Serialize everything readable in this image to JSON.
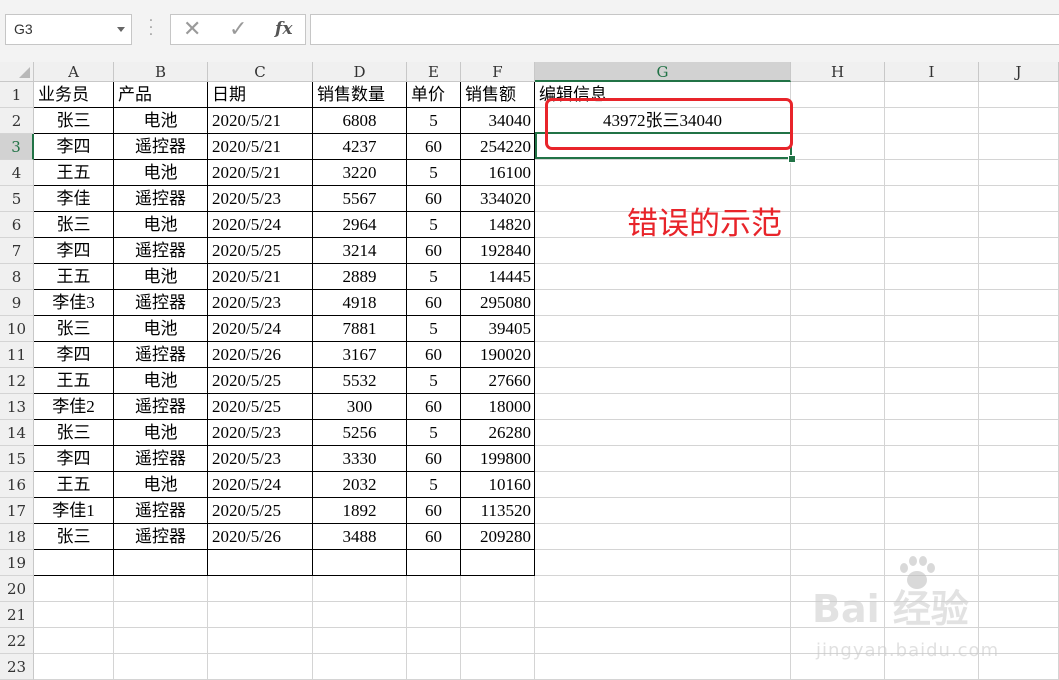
{
  "name_box": {
    "value": "G3"
  },
  "formula_bar": {
    "cancel_icon": "✕",
    "enter_icon": "✓",
    "fx_label": "fx",
    "formula": ""
  },
  "columns": [
    "A",
    "B",
    "C",
    "D",
    "E",
    "F",
    "G",
    "H",
    "I",
    "J"
  ],
  "selected_column": "G",
  "selected_row": 3,
  "row_numbers": [
    "1",
    "2",
    "3",
    "4",
    "5",
    "6",
    "7",
    "8",
    "9",
    "10",
    "11",
    "12",
    "13",
    "14",
    "15",
    "16",
    "17",
    "18",
    "19",
    "20",
    "21",
    "22",
    "23"
  ],
  "headers": [
    "业务员",
    "产品",
    "日期",
    "销售数量",
    "单价",
    "销售额",
    "编辑信息"
  ],
  "rows": [
    [
      "张三",
      "电池",
      "2020/5/21",
      "6808",
      "5",
      "34040"
    ],
    [
      "李四",
      "遥控器",
      "2020/5/21",
      "4237",
      "60",
      "254220"
    ],
    [
      "王五",
      "电池",
      "2020/5/21",
      "3220",
      "5",
      "16100"
    ],
    [
      "李佳",
      "遥控器",
      "2020/5/23",
      "5567",
      "60",
      "334020"
    ],
    [
      "张三",
      "电池",
      "2020/5/24",
      "2964",
      "5",
      "14820"
    ],
    [
      "李四",
      "遥控器",
      "2020/5/25",
      "3214",
      "60",
      "192840"
    ],
    [
      "王五",
      "电池",
      "2020/5/21",
      "2889",
      "5",
      "14445"
    ],
    [
      "李佳3",
      "遥控器",
      "2020/5/23",
      "4918",
      "60",
      "295080"
    ],
    [
      "张三",
      "电池",
      "2020/5/24",
      "7881",
      "5",
      "39405"
    ],
    [
      "李四",
      "遥控器",
      "2020/5/26",
      "3167",
      "60",
      "190020"
    ],
    [
      "王五",
      "电池",
      "2020/5/25",
      "5532",
      "5",
      "27660"
    ],
    [
      "李佳2",
      "遥控器",
      "2020/5/25",
      "300",
      "60",
      "18000"
    ],
    [
      "张三",
      "电池",
      "2020/5/23",
      "5256",
      "5",
      "26280"
    ],
    [
      "李四",
      "遥控器",
      "2020/5/23",
      "3330",
      "60",
      "199800"
    ],
    [
      "王五",
      "电池",
      "2020/5/24",
      "2032",
      "5",
      "10160"
    ],
    [
      "李佳1",
      "遥控器",
      "2020/5/25",
      "1892",
      "60",
      "113520"
    ],
    [
      "张三",
      "遥控器",
      "2020/5/26",
      "3488",
      "60",
      "209280"
    ]
  ],
  "g2_value": "43972张三34040",
  "annotation": "错误的示范",
  "colors": {
    "selection_green": "#217346",
    "annotation_red": "#e8242a"
  },
  "watermark": {
    "brand": "Bai 经验",
    "site": "jingyan.baidu.com"
  }
}
